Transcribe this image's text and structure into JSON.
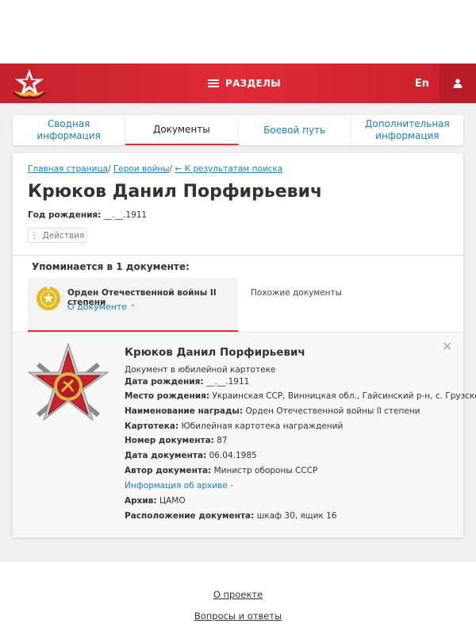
{
  "header": {
    "menu_label": "РАЗДЕЛЫ",
    "lang_label": "En",
    "brand_color": "#d9262f"
  },
  "tabs": [
    {
      "label": "Сводная информация"
    },
    {
      "label": "Документы"
    },
    {
      "label": "Боевой путь"
    },
    {
      "label": "Дополнительная информация"
    }
  ],
  "breadcrumbs": {
    "home": "Главная страница",
    "sep": "/",
    "heroes": "Герои войны",
    "back": "← К результатам поиска"
  },
  "person": {
    "name": "Крюков Данил Порфирьевич",
    "birth_label": "Год рождения:",
    "birth_value": "__.__.1911",
    "actions_label": "Действия"
  },
  "mentions": {
    "title": "Упоминается в 1 документе:",
    "doc_title": "Орден Отечественной войны II степени",
    "doc_link": "О документе",
    "similar": "Похожие документы"
  },
  "detail": {
    "name": "Крюков Данил Порфирьевич",
    "subtitle": "Документ в юбилейной картотеке",
    "fields": [
      {
        "label": "Дата рождения:",
        "value": "__.__.1911"
      },
      {
        "label": "Место рождения:",
        "value": "Украинская ССР, Винницкая обл., Гайсинский р-н, с. Грузское"
      },
      {
        "label": "Наименование награды:",
        "value": "Орден Отечественной войны II степени"
      },
      {
        "label": "Картотека:",
        "value": "Юбилейная картотека награждений"
      },
      {
        "label": "Номер документа:",
        "value": "87"
      },
      {
        "label": "Дата документа:",
        "value": "06.04.1985"
      },
      {
        "label": "Автор документа:",
        "value": "Министр обороны СССР"
      }
    ],
    "archive_link": "Информация об архиве -",
    "fields2": [
      {
        "label": "Архив:",
        "value": "ЦАМО"
      },
      {
        "label": "Расположение документа:",
        "value": "шкаф 30, ящик 16"
      }
    ]
  },
  "footer": {
    "about": "О проекте",
    "faq": "Вопросы и ответы"
  }
}
